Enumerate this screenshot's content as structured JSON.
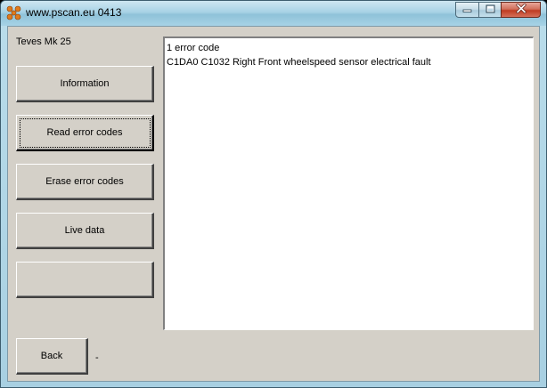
{
  "window": {
    "title": "www.pscan.eu 0413"
  },
  "ecu_label": "Teves Mk 25",
  "buttons": {
    "information": "Information",
    "read_error_codes": "Read error codes",
    "erase_error_codes": "Erase error codes",
    "live_data": "Live data",
    "empty": "",
    "back": "Back"
  },
  "output": {
    "lines": [
      "1 error code",
      "C1DA0 C1032 Right Front wheelspeed sensor electrical fault"
    ]
  },
  "status_text": "-",
  "icons": {
    "app": "pscan-app-icon",
    "minimize": "minimize-icon",
    "maximize": "maximize-icon",
    "close": "close-icon"
  },
  "colors": {
    "dialog_bg": "#d4d0c8",
    "titlebar": "#a8d2e5",
    "close_button": "#c84a30"
  }
}
